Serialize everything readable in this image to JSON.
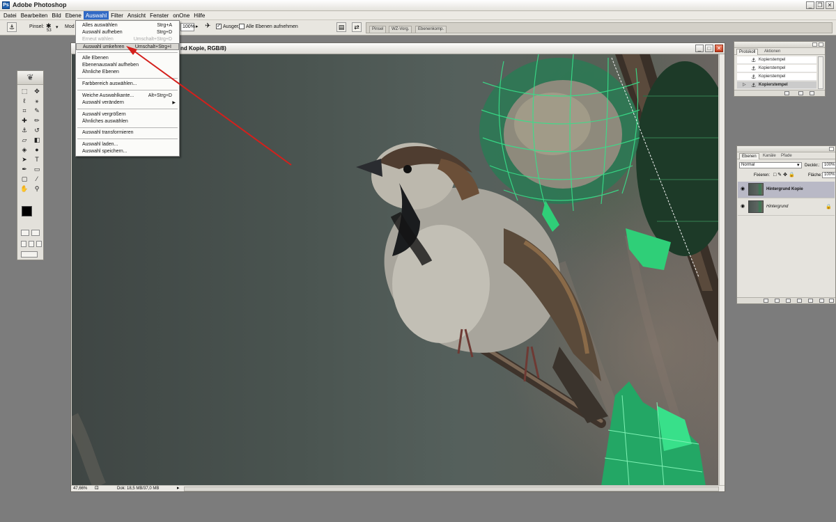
{
  "app": {
    "title": "Adobe Photoshop",
    "icon": "photoshop-icon",
    "window_buttons": [
      "_",
      "❐",
      "✕"
    ]
  },
  "menubar": {
    "items": [
      "Datei",
      "Bearbeiten",
      "Bild",
      "Ebene",
      "Auswahl",
      "Filter",
      "Ansicht",
      "Fenster",
      "onOne",
      "Hilfe"
    ],
    "active": "Auswahl"
  },
  "options": {
    "brush_label": "Pinsel:",
    "brush_size": "53",
    "mode_label": "Mod",
    "opacity_value": "100%",
    "aligned_label": "Ausger.",
    "aligned_checked": true,
    "all_layers_label": "Alle Ebenen aufnehmen",
    "all_layers_checked": false,
    "well_tabs": [
      "Pinsel",
      "WZ-Vorg.",
      "Ebenenkomp."
    ]
  },
  "menu_auswahl": {
    "items": [
      {
        "label": "Alles auswählen",
        "shortcut": "Strg+A",
        "disabled": false
      },
      {
        "label": "Auswahl aufheben",
        "shortcut": "Strg+D",
        "disabled": false
      },
      {
        "label": "Erneut wählen",
        "shortcut": "Umschalt+Strg+D",
        "disabled": true
      },
      {
        "label": "Auswahl umkehren",
        "shortcut": "Umschalt+Strg+I",
        "disabled": false,
        "highlighted": true
      },
      {
        "label": "Alle Ebenen",
        "shortcut": "",
        "disabled": false
      },
      {
        "label": "Ebenenauswahl aufheben",
        "shortcut": "",
        "disabled": false
      },
      {
        "label": "Ähnliche Ebenen",
        "shortcut": "",
        "disabled": false
      },
      {
        "label": "Farbbereich auswählen...",
        "shortcut": "",
        "disabled": false
      },
      {
        "label": "Weiche Auswahlkante...",
        "shortcut": "Alt+Strg+D",
        "disabled": false
      },
      {
        "label": "Auswahl verändern",
        "shortcut": "",
        "disabled": false,
        "submenu": true
      },
      {
        "label": "Auswahl vergrößern",
        "shortcut": "",
        "disabled": false
      },
      {
        "label": "Ähnliches auswählen",
        "shortcut": "",
        "disabled": false
      },
      {
        "label": "Auswahl transformieren",
        "shortcut": "",
        "disabled": false
      },
      {
        "label": "Auswahl laden...",
        "shortcut": "",
        "disabled": false
      },
      {
        "label": "Auswahl speichern...",
        "shortcut": "",
        "disabled": false
      }
    ]
  },
  "document": {
    "title_visible": "nd Kopie, RGB/8)",
    "zoom": "47,66%",
    "doc_info": "Dok: 18,5 MB/37,0 MB"
  },
  "protokoll": {
    "tabs": [
      "Protokoll",
      "Aktionen"
    ],
    "rows": [
      {
        "label": "Kopierstempel",
        "selected": false
      },
      {
        "label": "Kopierstempel",
        "selected": false
      },
      {
        "label": "Kopierstempel",
        "selected": false
      },
      {
        "label": "Kopierstempel",
        "selected": true
      }
    ]
  },
  "layers": {
    "tabs": [
      "Ebenen",
      "Kanäle",
      "Pfade"
    ],
    "blend_mode": "Normal",
    "opacity_label": "Deckkr.:",
    "opacity_value": "100%",
    "lock_label": "Fixieren:",
    "fill_label": "Fläche:",
    "fill_value": "100%",
    "rows": [
      {
        "name": "Hintergrund Kopie",
        "selected": true,
        "locked": false
      },
      {
        "name": "Hintergrund",
        "selected": false,
        "locked": true
      }
    ]
  },
  "colors": {
    "menu_highlight": "#316ac5",
    "arrow": "#d4201c",
    "net_green": "#27d27a"
  }
}
